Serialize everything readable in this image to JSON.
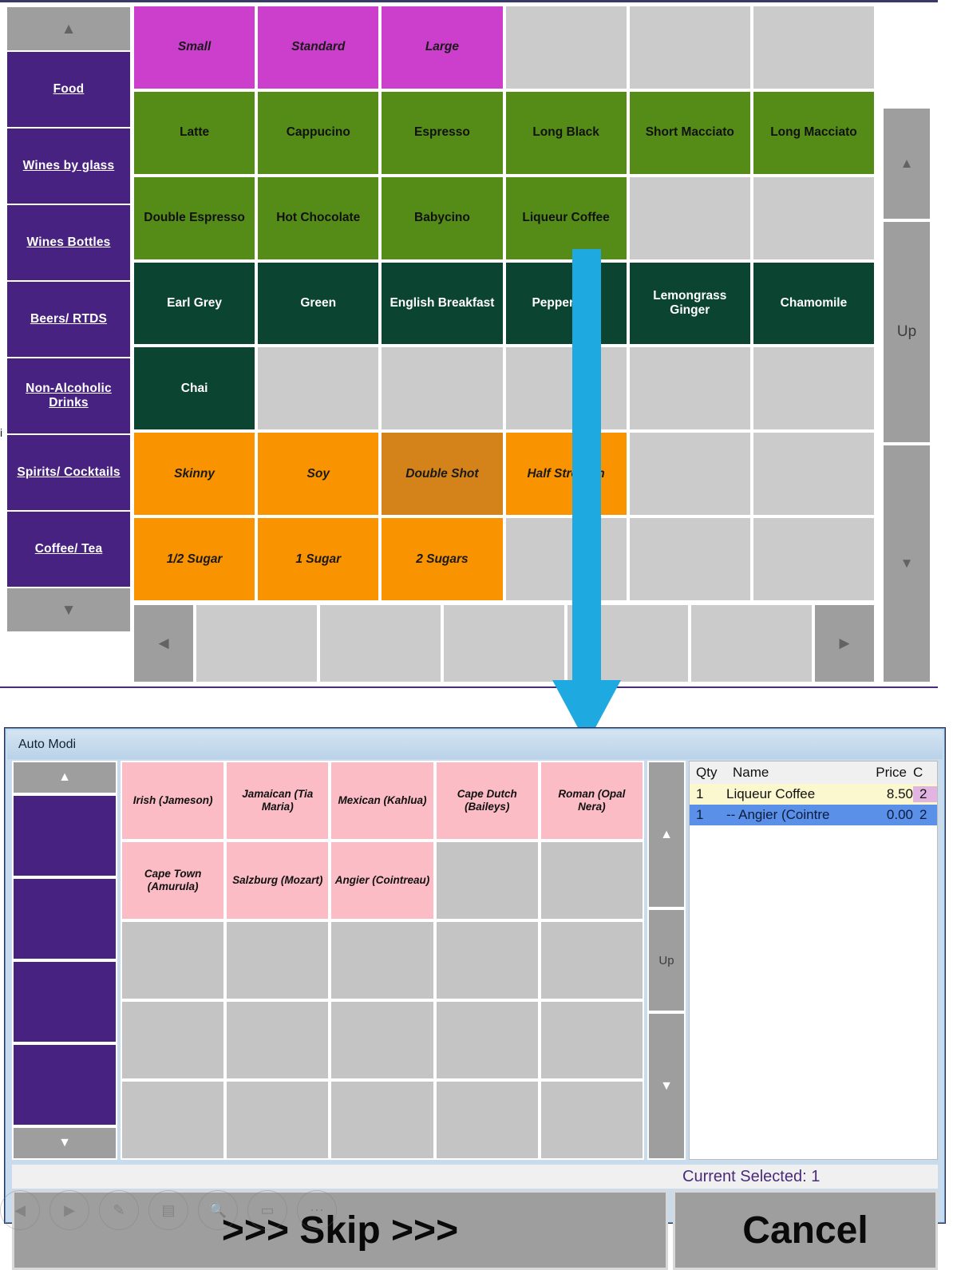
{
  "pos": {
    "rail": {
      "up_glyph": "▲",
      "down_glyph": "▼",
      "categories": [
        "Food",
        "Wines by glass",
        "Wines Bottles",
        "Beers/ RTDS",
        "Non-Alcoholic Drinks",
        "Spirits/ Cocktails",
        "Coffee/ Tea"
      ]
    },
    "stray_char": "i",
    "grid": {
      "rows": [
        [
          {
            "label": "Small",
            "style": "c-magenta"
          },
          {
            "label": "Standard",
            "style": "c-magenta"
          },
          {
            "label": "Large",
            "style": "c-magenta"
          },
          {
            "label": "",
            "style": "empty"
          },
          {
            "label": "",
            "style": "empty"
          },
          {
            "label": "",
            "style": "empty"
          }
        ],
        [
          {
            "label": "Latte",
            "style": "c-green"
          },
          {
            "label": "Cappucino",
            "style": "c-green"
          },
          {
            "label": "Espresso",
            "style": "c-green"
          },
          {
            "label": "Long Black",
            "style": "c-green"
          },
          {
            "label": "Short Macciato",
            "style": "c-green"
          },
          {
            "label": "Long Macciato",
            "style": "c-green"
          }
        ],
        [
          {
            "label": "Double Espresso",
            "style": "c-green"
          },
          {
            "label": "Hot Chocolate",
            "style": "c-green"
          },
          {
            "label": "Babycino",
            "style": "c-green"
          },
          {
            "label": "Liqueur Coffee",
            "style": "c-green"
          },
          {
            "label": "",
            "style": "empty"
          },
          {
            "label": "",
            "style": "empty"
          }
        ],
        [
          {
            "label": "Earl Grey",
            "style": "c-dgreen"
          },
          {
            "label": "Green",
            "style": "c-dgreen"
          },
          {
            "label": "English Breakfast",
            "style": "c-dgreen"
          },
          {
            "label": "Peppermint",
            "style": "c-dgreen"
          },
          {
            "label": "Lemongrass Ginger",
            "style": "c-dgreen"
          },
          {
            "label": "Chamomile",
            "style": "c-dgreen"
          }
        ],
        [
          {
            "label": "Chai",
            "style": "c-dgreen"
          },
          {
            "label": "",
            "style": "empty"
          },
          {
            "label": "",
            "style": "empty"
          },
          {
            "label": "",
            "style": "empty"
          },
          {
            "label": "",
            "style": "empty"
          },
          {
            "label": "",
            "style": "empty"
          }
        ],
        [
          {
            "label": "Skinny",
            "style": "c-orange"
          },
          {
            "label": "Soy",
            "style": "c-orange"
          },
          {
            "label": "Double Shot",
            "style": "c-orange-sel"
          },
          {
            "label": "Half Strength",
            "style": "c-orange"
          },
          {
            "label": "",
            "style": "empty"
          },
          {
            "label": "",
            "style": "empty"
          }
        ],
        [
          {
            "label": "1/2 Sugar",
            "style": "c-orange"
          },
          {
            "label": "1 Sugar",
            "style": "c-orange"
          },
          {
            "label": "2 Sugars",
            "style": "c-orange"
          },
          {
            "label": "",
            "style": "empty"
          },
          {
            "label": "",
            "style": "empty"
          },
          {
            "label": "",
            "style": "empty"
          }
        ]
      ]
    },
    "page_nav": {
      "prev_glyph": "◀",
      "next_glyph": "▶"
    },
    "scroll_rail": {
      "up_glyph": "▲",
      "label": "Up",
      "down_glyph": "▼"
    }
  },
  "dialog": {
    "title": "Auto Modi",
    "rail": {
      "up_glyph": "▲",
      "down_glyph": "▼",
      "category_count": 4
    },
    "grid": {
      "rows": [
        [
          {
            "label": "Irish (Jameson)",
            "style": "d-pink"
          },
          {
            "label": "Jamaican (Tia Maria)",
            "style": "d-pink"
          },
          {
            "label": "Mexican (Kahlua)",
            "style": "d-pink"
          },
          {
            "label": "Cape Dutch (Baileys)",
            "style": "d-pink"
          },
          {
            "label": "Roman (Opal Nera)",
            "style": "d-pink"
          }
        ],
        [
          {
            "label": "Cape Town (Amurula)",
            "style": "d-pink"
          },
          {
            "label": "Salzburg (Mozart)",
            "style": "d-pink"
          },
          {
            "label": "Angier (Cointreau)",
            "style": "d-pink"
          },
          {
            "label": "",
            "style": "empty"
          },
          {
            "label": "",
            "style": "empty"
          }
        ],
        [
          {
            "label": "",
            "style": "empty"
          },
          {
            "label": "",
            "style": "empty"
          },
          {
            "label": "",
            "style": "empty"
          },
          {
            "label": "",
            "style": "empty"
          },
          {
            "label": "",
            "style": "empty"
          }
        ],
        [
          {
            "label": "",
            "style": "empty"
          },
          {
            "label": "",
            "style": "empty"
          },
          {
            "label": "",
            "style": "empty"
          },
          {
            "label": "",
            "style": "empty"
          },
          {
            "label": "",
            "style": "empty"
          }
        ],
        [
          {
            "label": "",
            "style": "empty"
          },
          {
            "label": "",
            "style": "empty"
          },
          {
            "label": "",
            "style": "empty"
          },
          {
            "label": "",
            "style": "empty"
          },
          {
            "label": "",
            "style": "empty"
          }
        ]
      ]
    },
    "scroll_rail": {
      "up_glyph": "▲",
      "label": "Up",
      "down_glyph": "▼"
    },
    "order": {
      "headers": {
        "qty": "Qty",
        "name": "Name",
        "price": "Price",
        "c": "C"
      },
      "rows": [
        {
          "qty": "1",
          "name": "Liqueur Coffee",
          "price": "8.50",
          "c": "2",
          "style": "row-y"
        },
        {
          "qty": "1",
          "name": "-- Angier (Cointre",
          "price": "0.00",
          "c": "2",
          "style": "row-b"
        }
      ]
    },
    "status": "Current Selected: 1",
    "actions": {
      "skip": ">>> Skip >>>",
      "cancel": "Cancel"
    }
  },
  "float_toolbar": {
    "icons": [
      "back-icon",
      "forward-icon",
      "pen-icon",
      "layout-icon",
      "search-icon",
      "note-icon",
      "more-icon"
    ],
    "glyphs": [
      "◀",
      "▶",
      "✎",
      "▤",
      "🔍",
      "▭",
      "⋯"
    ]
  },
  "colors": {
    "magenta": "#cc3fcc",
    "green": "#558c18",
    "dark_green": "#0b4430",
    "orange": "#fa9300",
    "orange_selected": "#d4821a",
    "purple": "#472280",
    "pink": "#fbbcc5",
    "empty_gray": "#cbcbcb",
    "arrow_blue": "#1eaae0"
  }
}
